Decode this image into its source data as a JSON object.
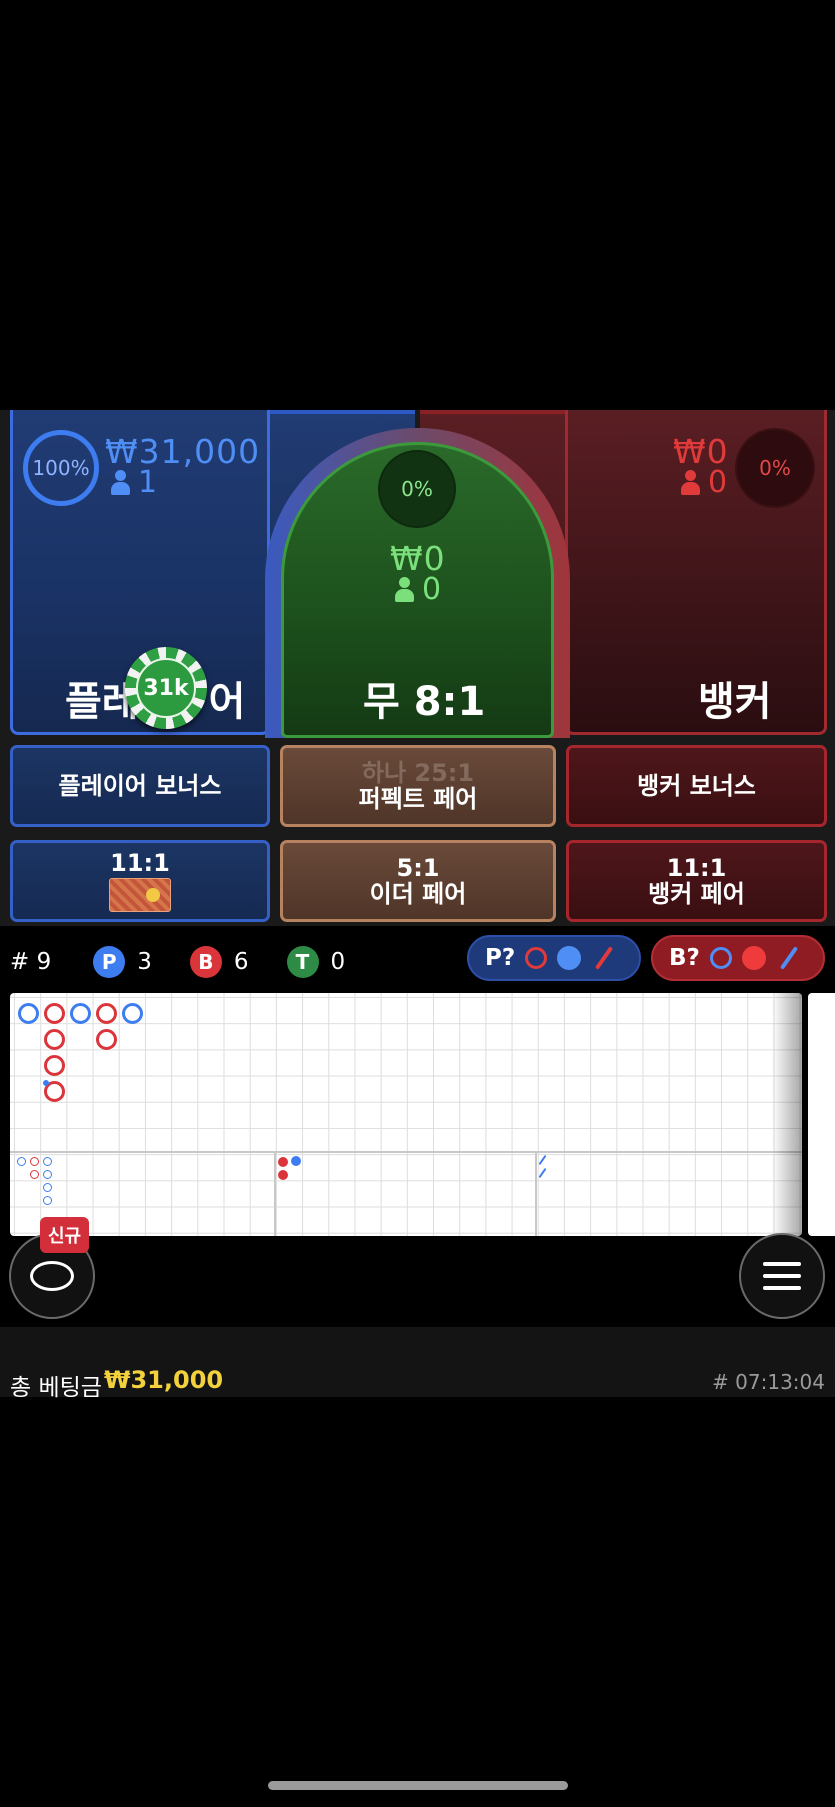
{
  "player": {
    "percent": "100%",
    "amount": "₩31,000",
    "count": "1",
    "label_left": "플레",
    "label_right": "어",
    "chip": "31k"
  },
  "tie": {
    "percent": "0%",
    "amount": "₩0",
    "count": "0",
    "label": "무 8:1"
  },
  "banker": {
    "percent": "0%",
    "amount": "₩0",
    "count": "0",
    "label": "뱅커"
  },
  "side_bets": {
    "player_bonus": "플레이어 보너스",
    "perfect_pair_sub": "하나 25:1",
    "perfect_pair": "퍼펙트 페어",
    "banker_bonus": "뱅커 보너스",
    "player_pair_odds": "11:1",
    "either_pair_odds": "5:1",
    "either_pair": "이더 페어",
    "banker_pair_odds": "11:1",
    "banker_pair": "뱅커 페어"
  },
  "stats": {
    "round_label": "# 9",
    "p_letter": "P",
    "p_count": "3",
    "b_letter": "B",
    "b_count": "6",
    "t_letter": "T",
    "t_count": "0",
    "p_predict": "P?",
    "b_predict": "B?"
  },
  "colors": {
    "player": "#3d7df0",
    "banker": "#d9353b",
    "tie": "#2e8b45",
    "gold": "#f2d13c"
  },
  "bottom": {
    "new_badge": "신규",
    "total_label": "총 베팅금",
    "total_value": "₩31,000",
    "clock": "# 07:13:04"
  },
  "icons": {
    "chat": "chat-bubble-icon",
    "menu": "hamburger-menu-icon"
  }
}
